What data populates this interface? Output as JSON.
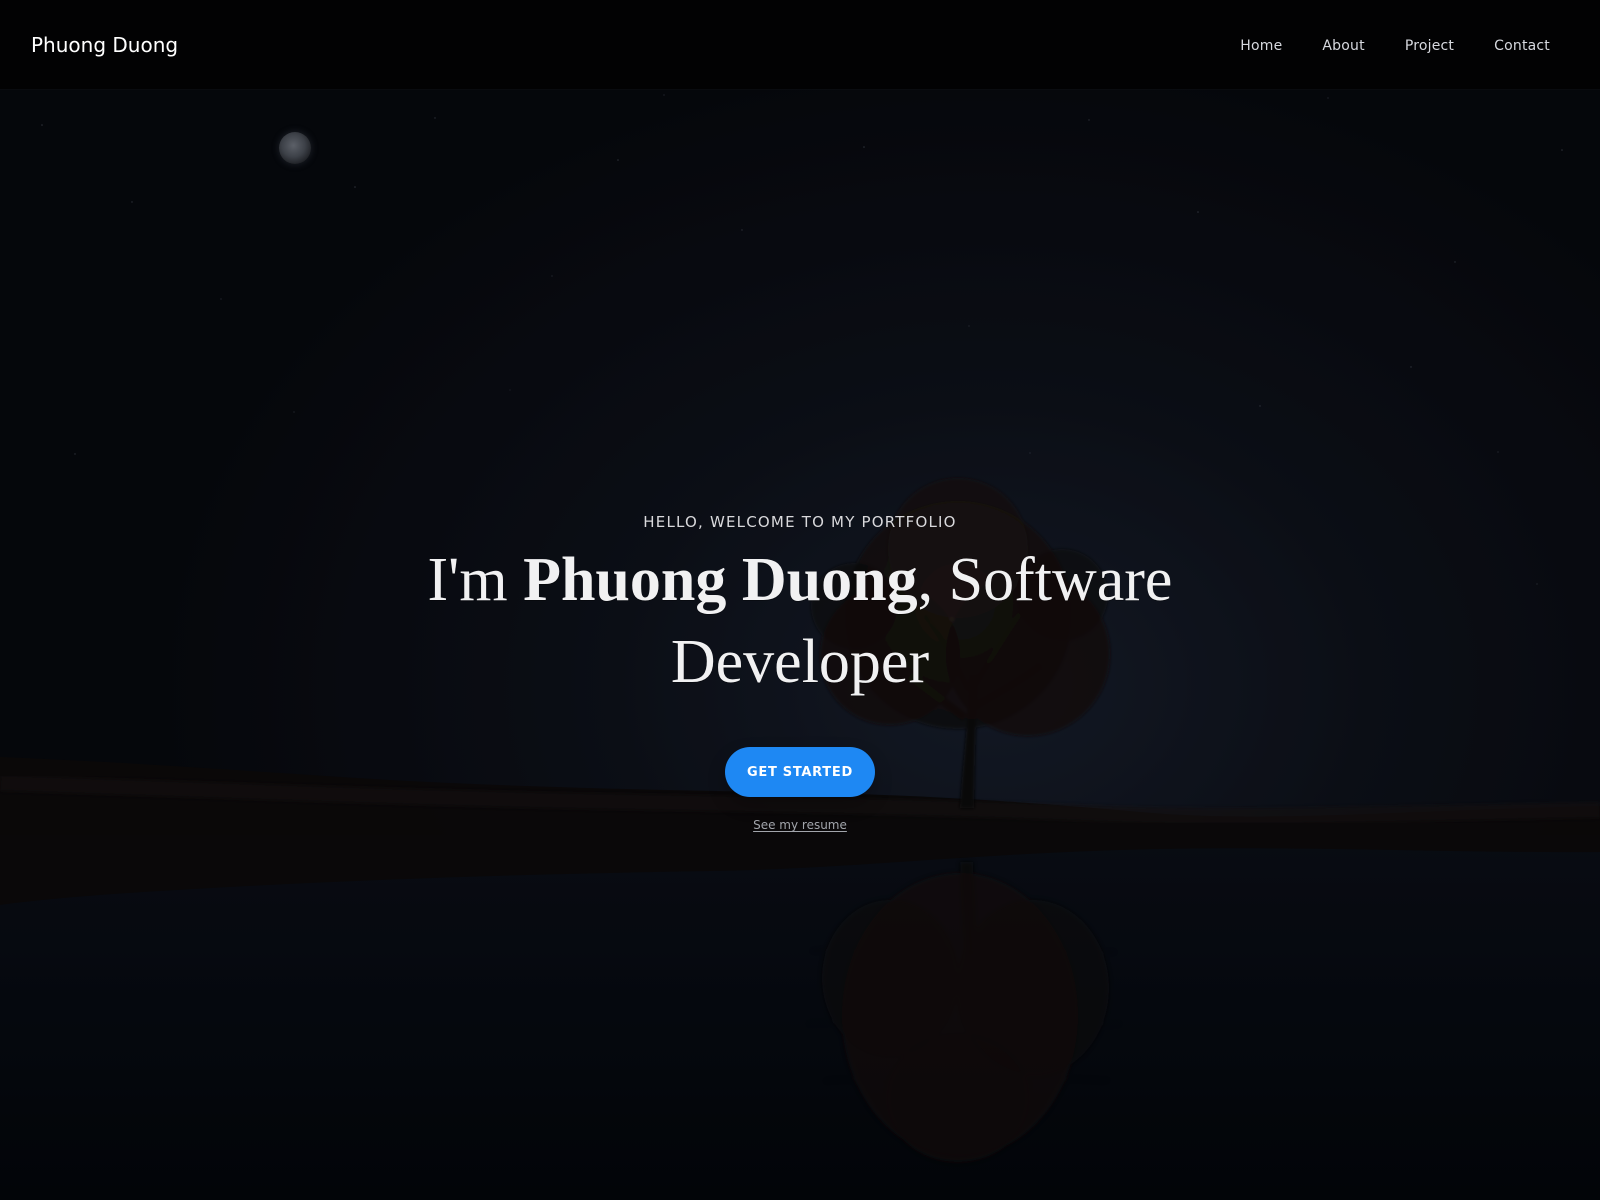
{
  "header": {
    "brand": "Phuong Duong",
    "nav": [
      "Home",
      "About",
      "Project",
      "Contact"
    ]
  },
  "hero": {
    "eyebrow": "HELLO, WELCOME TO MY PORTFOLIO",
    "headline_prefix": "I'm ",
    "headline_name": "Phuong Duong",
    "headline_suffix": ", Software Developer",
    "cta_label": "GET STARTED",
    "resume_label": "See my resume"
  },
  "icons": {
    "moon": "moon-icon"
  },
  "colors": {
    "navbar": "#020203",
    "button": "#1e88f3",
    "text": "#f1f1f2"
  }
}
